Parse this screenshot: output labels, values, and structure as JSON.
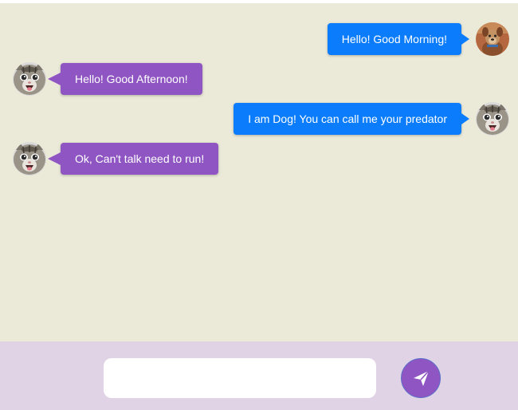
{
  "colors": {
    "chat_background": "#ebe9d8",
    "composer_background": "#e0d3e6",
    "sent_bubble": "#0b7dfc",
    "received_bubble": "#8f55c2",
    "send_button": "#8f55c2"
  },
  "messages": [
    {
      "text": "Hello! Good Morning!",
      "direction": "sent",
      "avatar": "dog-avatar"
    },
    {
      "text": "Hello! Good Afternoon!",
      "direction": "received",
      "avatar": "cat-avatar"
    },
    {
      "text": "I am Dog! You can call me your predator",
      "direction": "sent",
      "avatar": "cat-avatar"
    },
    {
      "text": "Ok, Can't talk need to run!",
      "direction": "received",
      "avatar": "cat-avatar"
    }
  ],
  "composer": {
    "input_value": "",
    "input_placeholder": "",
    "send_icon": "paper-plane-icon"
  }
}
